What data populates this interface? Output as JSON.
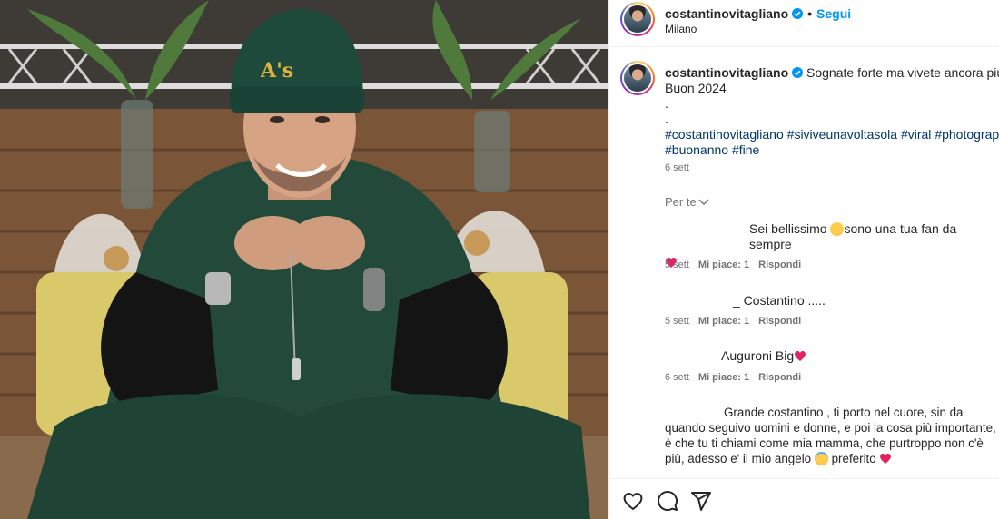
{
  "post": {
    "username": "costantinovitagliano",
    "verified": true,
    "follow_separator": "•",
    "follow_label": "Segui",
    "location": "Milano",
    "caption_line1": "Sognate forte ma vivete ancora più fort",
    "caption_line2": "Buon 2024",
    "caption_dot1": ".",
    "caption_dot2": ".",
    "hashtags_line1": [
      "#costantinovitagliano",
      "#siviveunavoltasola",
      "#viral",
      "#photography"
    ],
    "hashtags_line2": [
      "#buonanno",
      "#fine"
    ],
    "time": "6 sett",
    "filter_label": "Per te"
  },
  "comments": [
    {
      "text_a": "Sei bellissimo",
      "emoji": "heart-eyes-emoji",
      "text_b": "sono una tua fan da sempre",
      "time": "5 sett",
      "likes": "Mi piace: 1",
      "reply": "Rispondi"
    },
    {
      "text": "_ Costantino .....",
      "time": "5 sett",
      "likes": "Mi piace: 1",
      "reply": "Rispondi"
    },
    {
      "text": "Auguroni Big",
      "time": "6 sett",
      "likes": "Mi piace: 1",
      "reply": "Rispondi"
    },
    {
      "line1": "Grande costantino , ti porto nel cuore, sin da",
      "line2": "quando seguivo uomini e donne, e poi la cosa più importante,",
      "line3": "è che tu ti chiami come mia mamma, che purtroppo non c'è",
      "line4a": "più, adesso e' il mio angelo",
      "line4b": "preferito",
      "emoji": "angel-smile-emoji"
    }
  ],
  "icons": {
    "like": "heart-outline-icon",
    "comment": "comment-bubble-icon",
    "share": "paper-plane-icon",
    "verified": "verified-badge-icon",
    "chevron": "chevron-down-icon"
  },
  "colors": {
    "link_blue": "#0095f6",
    "hashtag_blue": "#00376b",
    "secondary_text": "#737373",
    "heart_red": "#e0245e"
  }
}
